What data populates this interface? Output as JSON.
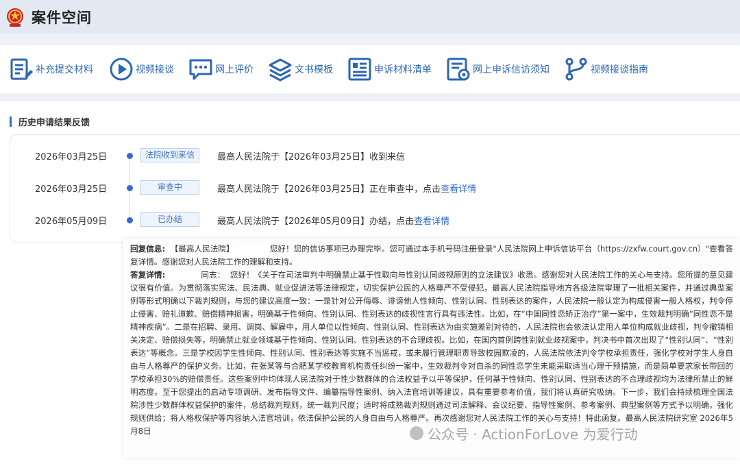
{
  "header": {
    "title": "案件空间",
    "colors": {
      "bar_bg": "#e3e9f3",
      "accent": "#2b66b1"
    }
  },
  "toolbar": {
    "items": [
      {
        "label": "补充提交材料",
        "icon": "document-edit-icon"
      },
      {
        "label": "视频接谈",
        "icon": "video-play-icon"
      },
      {
        "label": "网上评价",
        "icon": "chat-bubble-icon"
      },
      {
        "label": "文书模板",
        "icon": "layers-icon"
      },
      {
        "label": "申诉材料清单",
        "icon": "list-document-icon"
      },
      {
        "label": "网上申诉信访须知",
        "icon": "notice-document-icon"
      },
      {
        "label": "视频接谈指南",
        "icon": "branch-flow-icon"
      }
    ]
  },
  "history": {
    "title": "历史申请结果反馈",
    "rows": [
      {
        "date": "2026年03月25日",
        "status": "法院收到来信",
        "desc": "最高人民法院于【2026年03月25日】收到来信",
        "link": ""
      },
      {
        "date": "2026年03月25日",
        "status": "审查中",
        "desc": "最高人民法院于【2026年03月25日】正在审查中，点击",
        "link": "查看详情"
      },
      {
        "date": "2026年05月09日",
        "status": "已办结",
        "desc": "最高人民法院于【2026年05月09日】办结，点击",
        "link": "查看详情"
      }
    ]
  },
  "reply": {
    "info_label": "回复信息:",
    "info_text_1": "【最高人民法院】",
    "info_text_2": "您好！您的信访事项已办理完毕。您可通过本手机号码注册登录\"人民法院网上申诉信访平台（https://zxfw.court.gov.cn）\"查看答复详情。感谢您对人民法院工作的理解和支持。",
    "detail_label": "答复详情:",
    "detail_text_1": "同志：",
    "detail_text_2": "您好！《关于在司法审判中明确禁止基于性取向与性别认同歧视原则的立法建议》收悉。感谢您对人民法院工作的关心与支持。您所提的意见建议很有价值。为贯彻落实宪法、民法典、就业促进法等法律规定，切实保护公民的人格尊严不受侵犯，最高人民法院指导地方各级法院审理了一批相关案件，并通过典型案例等形式明确以下裁判规则，与您的建议高度一致：一是针对公开侮辱、诽谤他人性倾向、性别认同、性别表达的案件，人民法院一般认定为构成侵害一般人格权，判令停止侵害、赔礼道歉、赔偿精神损害，明确基于性倾向、性别认同、性别表达的歧视性言行具有违法性。比如，在“中国同性恋矫正治疗”第一案中，生效裁判明确“同性恋不是精神疾病”。二是在招聘、录用、调岗、解雇中，用人单位以性倾向、性别认同、性别表达为由实施差别对待的，人民法院也会依法认定用人单位构成就业歧视，判令撤销相关决定、赔偿损失等，明确禁止就业领域基于性倾向、性别认同、性别表达的不合理歧视。比如，在国内首例跨性别就业歧视案中，判决书中首次出现了“性别认同”、“性别表达”等概念。三是学校因学生性倾向、性别认同、性别表达等实施不当惩戒，或未履行管理职责导致校园欺凌的，人民法院依法判令学校承担责任，强化学校对学生人身自由与人格尊严的保护义务。比如，在张某等与合肥某学校教育机构责任纠纷一案中，生效裁判令对自杀的同性恋学生未能采取适当心理干预措施，而是简单要求家长带回的学校承担30%的赔偿责任。这些案例中均体现人民法院对于性少数群体的合法权益予以平等保护，任何基于性倾向、性别认同、性别表达的不合理歧视均为法律所禁止的鲜明态度。至于您提出的启动专项调研、发布指导文件、编纂指导性案例、纳入法官培训等建议，具有重要参考价值，我们将认真研究吸纳。下一步，我们会持续梳理全国法院涉性少数群体权益保护的案件，总结裁判规则，统一裁判尺度；适时将成熟裁判规则通过司法解释、会议纪要、指导性案例、参考案例、典型案例等方式予以明确，强化规则供给；将人格权保护等内容纳入法官培训，依法保护公民的人身自由与人格尊严。再次感谢您对人民法院工作的关心与支持！特此函复。最高人民法院研究室 2026年5月8日"
  },
  "watermark": {
    "text": "公众号 · ActionForLove 为爱行动"
  }
}
